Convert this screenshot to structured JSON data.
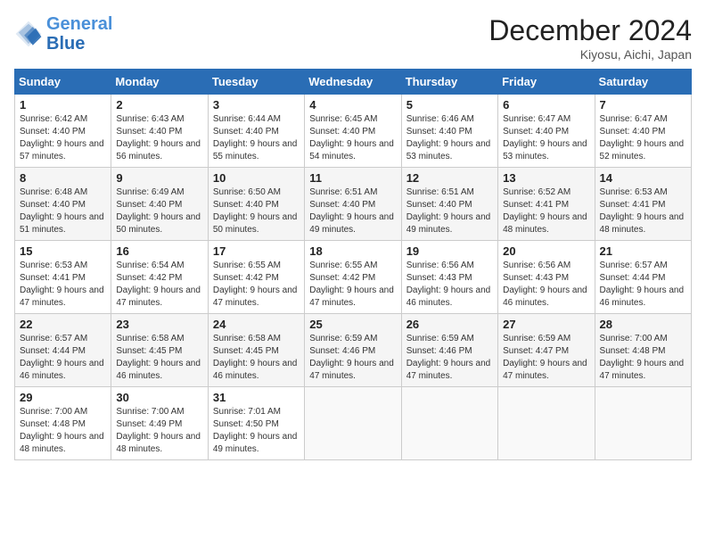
{
  "header": {
    "logo_line1": "General",
    "logo_line2": "Blue",
    "month_title": "December 2024",
    "location": "Kiyosu, Aichi, Japan"
  },
  "weekdays": [
    "Sunday",
    "Monday",
    "Tuesday",
    "Wednesday",
    "Thursday",
    "Friday",
    "Saturday"
  ],
  "weeks": [
    [
      {
        "day": "1",
        "sunrise": "6:42 AM",
        "sunset": "4:40 PM",
        "daylight": "9 hours and 57 minutes."
      },
      {
        "day": "2",
        "sunrise": "6:43 AM",
        "sunset": "4:40 PM",
        "daylight": "9 hours and 56 minutes."
      },
      {
        "day": "3",
        "sunrise": "6:44 AM",
        "sunset": "4:40 PM",
        "daylight": "9 hours and 55 minutes."
      },
      {
        "day": "4",
        "sunrise": "6:45 AM",
        "sunset": "4:40 PM",
        "daylight": "9 hours and 54 minutes."
      },
      {
        "day": "5",
        "sunrise": "6:46 AM",
        "sunset": "4:40 PM",
        "daylight": "9 hours and 53 minutes."
      },
      {
        "day": "6",
        "sunrise": "6:47 AM",
        "sunset": "4:40 PM",
        "daylight": "9 hours and 53 minutes."
      },
      {
        "day": "7",
        "sunrise": "6:47 AM",
        "sunset": "4:40 PM",
        "daylight": "9 hours and 52 minutes."
      }
    ],
    [
      {
        "day": "8",
        "sunrise": "6:48 AM",
        "sunset": "4:40 PM",
        "daylight": "9 hours and 51 minutes."
      },
      {
        "day": "9",
        "sunrise": "6:49 AM",
        "sunset": "4:40 PM",
        "daylight": "9 hours and 50 minutes."
      },
      {
        "day": "10",
        "sunrise": "6:50 AM",
        "sunset": "4:40 PM",
        "daylight": "9 hours and 50 minutes."
      },
      {
        "day": "11",
        "sunrise": "6:51 AM",
        "sunset": "4:40 PM",
        "daylight": "9 hours and 49 minutes."
      },
      {
        "day": "12",
        "sunrise": "6:51 AM",
        "sunset": "4:40 PM",
        "daylight": "9 hours and 49 minutes."
      },
      {
        "day": "13",
        "sunrise": "6:52 AM",
        "sunset": "4:41 PM",
        "daylight": "9 hours and 48 minutes."
      },
      {
        "day": "14",
        "sunrise": "6:53 AM",
        "sunset": "4:41 PM",
        "daylight": "9 hours and 48 minutes."
      }
    ],
    [
      {
        "day": "15",
        "sunrise": "6:53 AM",
        "sunset": "4:41 PM",
        "daylight": "9 hours and 47 minutes."
      },
      {
        "day": "16",
        "sunrise": "6:54 AM",
        "sunset": "4:42 PM",
        "daylight": "9 hours and 47 minutes."
      },
      {
        "day": "17",
        "sunrise": "6:55 AM",
        "sunset": "4:42 PM",
        "daylight": "9 hours and 47 minutes."
      },
      {
        "day": "18",
        "sunrise": "6:55 AM",
        "sunset": "4:42 PM",
        "daylight": "9 hours and 47 minutes."
      },
      {
        "day": "19",
        "sunrise": "6:56 AM",
        "sunset": "4:43 PM",
        "daylight": "9 hours and 46 minutes."
      },
      {
        "day": "20",
        "sunrise": "6:56 AM",
        "sunset": "4:43 PM",
        "daylight": "9 hours and 46 minutes."
      },
      {
        "day": "21",
        "sunrise": "6:57 AM",
        "sunset": "4:44 PM",
        "daylight": "9 hours and 46 minutes."
      }
    ],
    [
      {
        "day": "22",
        "sunrise": "6:57 AM",
        "sunset": "4:44 PM",
        "daylight": "9 hours and 46 minutes."
      },
      {
        "day": "23",
        "sunrise": "6:58 AM",
        "sunset": "4:45 PM",
        "daylight": "9 hours and 46 minutes."
      },
      {
        "day": "24",
        "sunrise": "6:58 AM",
        "sunset": "4:45 PM",
        "daylight": "9 hours and 46 minutes."
      },
      {
        "day": "25",
        "sunrise": "6:59 AM",
        "sunset": "4:46 PM",
        "daylight": "9 hours and 47 minutes."
      },
      {
        "day": "26",
        "sunrise": "6:59 AM",
        "sunset": "4:46 PM",
        "daylight": "9 hours and 47 minutes."
      },
      {
        "day": "27",
        "sunrise": "6:59 AM",
        "sunset": "4:47 PM",
        "daylight": "9 hours and 47 minutes."
      },
      {
        "day": "28",
        "sunrise": "7:00 AM",
        "sunset": "4:48 PM",
        "daylight": "9 hours and 47 minutes."
      }
    ],
    [
      {
        "day": "29",
        "sunrise": "7:00 AM",
        "sunset": "4:48 PM",
        "daylight": "9 hours and 48 minutes."
      },
      {
        "day": "30",
        "sunrise": "7:00 AM",
        "sunset": "4:49 PM",
        "daylight": "9 hours and 48 minutes."
      },
      {
        "day": "31",
        "sunrise": "7:01 AM",
        "sunset": "4:50 PM",
        "daylight": "9 hours and 49 minutes."
      },
      null,
      null,
      null,
      null
    ]
  ]
}
